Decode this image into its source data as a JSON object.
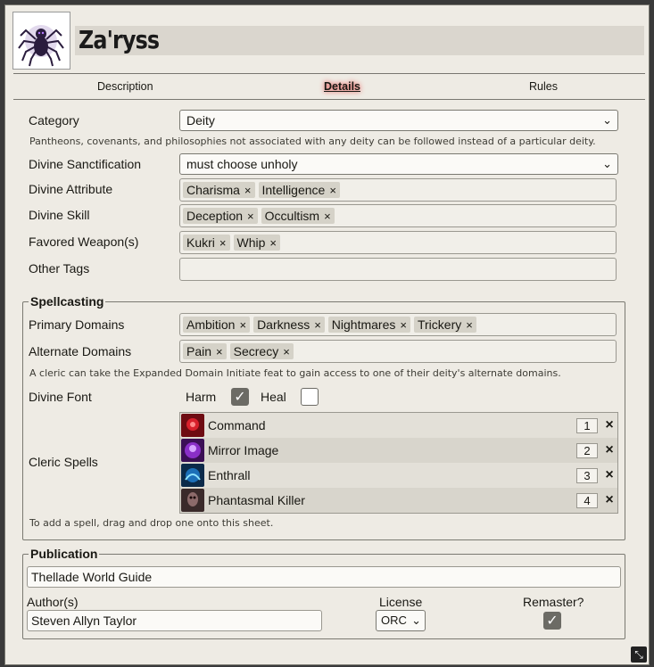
{
  "header": {
    "name": "Za'ryss"
  },
  "tabs": [
    "Description",
    "Details",
    "Rules"
  ],
  "details": {
    "category_label": "Category",
    "category_value": "Deity",
    "category_hint": "Pantheons, covenants, and philosophies not associated with any deity can be followed instead of a particular deity.",
    "sanctification_label": "Divine Sanctification",
    "sanctification_value": "must choose unholy",
    "attribute_label": "Divine Attribute",
    "attributes": [
      "Charisma",
      "Intelligence"
    ],
    "skill_label": "Divine Skill",
    "skills": [
      "Deception",
      "Occultism"
    ],
    "weapons_label": "Favored Weapon(s)",
    "weapons": [
      "Kukri",
      "Whip"
    ],
    "other_tags_label": "Other Tags"
  },
  "spellcasting": {
    "legend": "Spellcasting",
    "primary_label": "Primary Domains",
    "primary_domains": [
      "Ambition",
      "Darkness",
      "Nightmares",
      "Trickery"
    ],
    "alternate_label": "Alternate Domains",
    "alternate_domains": [
      "Pain",
      "Secrecy"
    ],
    "alternate_hint": "A cleric can take the Expanded Domain Initiate feat to gain access to one of their deity's alternate domains.",
    "font_label": "Divine Font",
    "harm_label": "Harm",
    "harm_checked": true,
    "heal_label": "Heal",
    "heal_checked": false,
    "cleric_spells_label": "Cleric Spells",
    "spells": [
      {
        "name": "Command",
        "rank": "1"
      },
      {
        "name": "Mirror Image",
        "rank": "2"
      },
      {
        "name": "Enthrall",
        "rank": "3"
      },
      {
        "name": "Phantasmal Killer",
        "rank": "4"
      }
    ],
    "spells_hint": "To add a spell, drag and drop one onto this sheet."
  },
  "publication": {
    "legend": "Publication",
    "title_value": "Thellade World Guide",
    "authors_label": "Author(s)",
    "authors_value": "Steven Allyn Taylor",
    "license_label": "License",
    "license_value": "ORC",
    "remaster_label": "Remaster?",
    "remaster_checked": true
  },
  "icons": {
    "remove": "×",
    "chevron": "⌄",
    "check": "✓",
    "resize": "⤡"
  }
}
